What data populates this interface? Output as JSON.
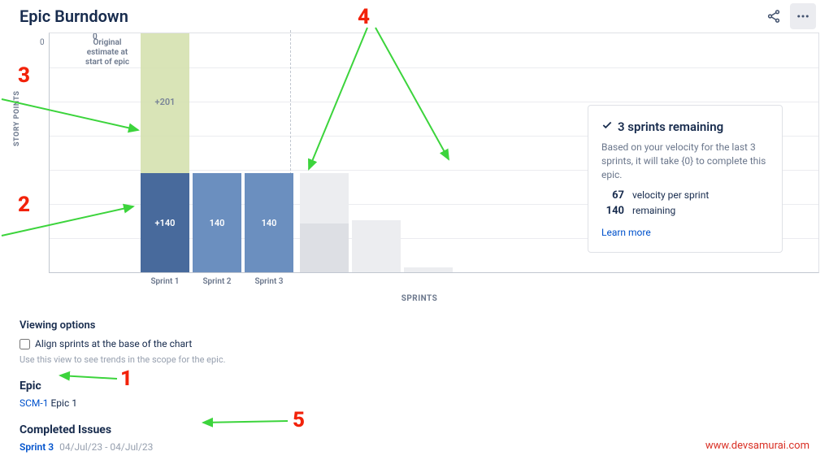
{
  "header": {
    "title": "Epic Burndown"
  },
  "chart_data": {
    "type": "bar",
    "title": "Epic Burndown",
    "ylabel": "STORY POINTS",
    "xlabel": "SPRINTS",
    "ylim": [
      0,
      341
    ],
    "zero_label": "0",
    "origin_label": "Original estimate at start of epic",
    "completed_sprints": [
      {
        "name": "Sprint 1",
        "scope_added": 201,
        "scope_label": "+201",
        "work_done": 140,
        "work_label": "+140"
      },
      {
        "name": "Sprint 2",
        "scope_added": 0,
        "scope_label": "",
        "work_done": 140,
        "work_label": "140"
      },
      {
        "name": "Sprint 3",
        "scope_added": 0,
        "scope_label": "",
        "work_done": 140,
        "work_label": "140"
      }
    ],
    "forecast_sprints": [
      {
        "remaining": 140
      },
      {
        "remaining": 73
      },
      {
        "remaining": 6
      }
    ]
  },
  "info_card": {
    "title": "3 sprints remaining",
    "description": "Based on your velocity for the last 3 sprints, it will take {0} to complete this epic.",
    "stat1_num": "67",
    "stat1_label": "velocity per sprint",
    "stat2_num": "140",
    "stat2_label": "remaining",
    "link": "Learn more"
  },
  "viewing": {
    "heading": "Viewing options",
    "checkbox_label": "Align sprints at the base of the chart",
    "hint": "Use this view to see trends in the scope for the epic."
  },
  "epic": {
    "heading": "Epic",
    "key": "SCM-1",
    "name": "Epic 1"
  },
  "completed": {
    "heading": "Completed Issues",
    "sprint_name": "Sprint 3",
    "sprint_dates": "04/Jul/23 - 04/Jul/23"
  },
  "annotations": {
    "n1": "1",
    "n2": "2",
    "n3": "3",
    "n4": "4",
    "n5": "5"
  },
  "credit": "www.devsamurai.com"
}
